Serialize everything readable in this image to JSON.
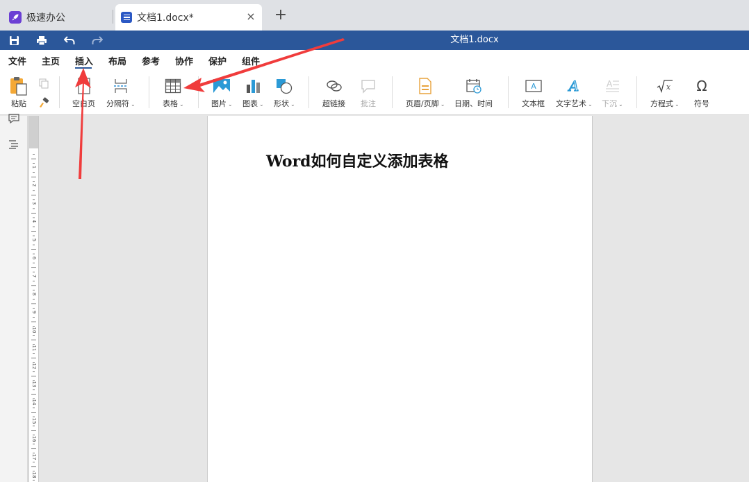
{
  "tabs": {
    "home_label": "极速办公",
    "doc_label": "文档1.docx*",
    "close_glyph": "×",
    "add_glyph": "+"
  },
  "titlebar": {
    "title": "文档1.docx"
  },
  "menu": {
    "items": [
      "文件",
      "主页",
      "插入",
      "布局",
      "参考",
      "协作",
      "保护",
      "组件"
    ],
    "active": "插入"
  },
  "ribbon": {
    "paste": "粘贴",
    "blank_page": "空白页",
    "separator": "分隔符",
    "table": "表格",
    "picture": "图片",
    "chart": "图表",
    "shape": "形状",
    "hyperlink": "超链接",
    "comment": "批注",
    "header_footer": "页眉/页脚",
    "date_time": "日期、时间",
    "textbox": "文本框",
    "wordart": "文字艺术",
    "dropcap": "下沉",
    "equation": "方程式",
    "symbol": "符号",
    "caret": "⌄"
  },
  "ruler": {
    "numbers": [
      "1",
      "2",
      "3",
      "4",
      "5",
      "6",
      "7",
      "8",
      "9",
      "10",
      "11",
      "12",
      "13",
      "14",
      "15",
      "16",
      "17",
      "18"
    ]
  },
  "document": {
    "heading": "Word如何自定义添加表格"
  },
  "colors": {
    "accent": "#2b579a",
    "arrow": "#f03c3c"
  }
}
